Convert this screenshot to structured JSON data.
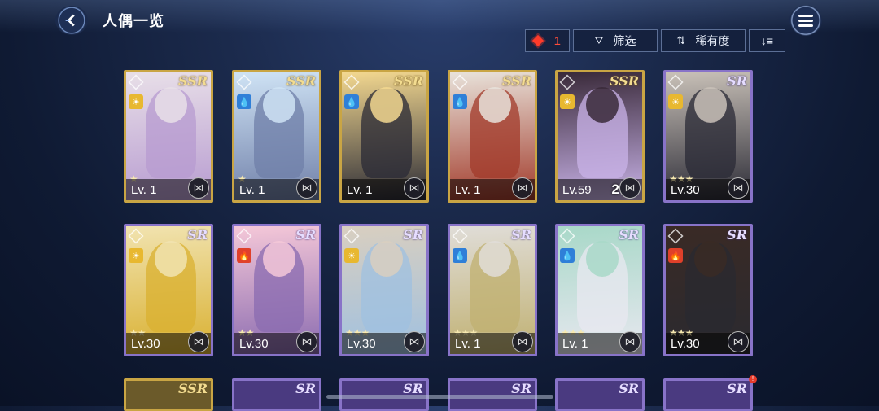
{
  "header": {
    "title": "人偶一览"
  },
  "toolbar": {
    "count": "1",
    "filter_label": "筛选",
    "rarity_label": "稀有度",
    "colors": {
      "accent": "#ff3b2a",
      "border": "#5c6f96"
    }
  },
  "cards": [
    {
      "rarity": "SSR",
      "level": "Lv. 1",
      "dup": "",
      "element": "light",
      "stars": 1
    },
    {
      "rarity": "SSR",
      "level": "Lv. 1",
      "dup": "",
      "element": "water",
      "stars": 1
    },
    {
      "rarity": "SSR",
      "level": "Lv. 1",
      "dup": "",
      "element": "water",
      "stars": 0
    },
    {
      "rarity": "SSR",
      "level": "Lv. 1",
      "dup": "",
      "element": "water",
      "stars": 0
    },
    {
      "rarity": "SSR",
      "level": "Lv.59",
      "dup": "2",
      "element": "light",
      "stars": 0
    },
    {
      "rarity": "SR",
      "level": "Lv.30",
      "dup": "",
      "element": "light",
      "stars": 3
    },
    {
      "rarity": "SR",
      "level": "Lv.30",
      "dup": "",
      "element": "light",
      "stars": 2
    },
    {
      "rarity": "SR",
      "level": "Lv.30",
      "dup": "",
      "element": "fire",
      "stars": 2
    },
    {
      "rarity": "SR",
      "level": "Lv.30",
      "dup": "",
      "element": "light",
      "stars": 3
    },
    {
      "rarity": "SR",
      "level": "Lv. 1",
      "dup": "",
      "element": "water",
      "stars": 3
    },
    {
      "rarity": "SR",
      "level": "Lv. 1",
      "dup": "",
      "element": "water",
      "stars": 3
    },
    {
      "rarity": "SR",
      "level": "Lv.30",
      "dup": "",
      "element": "fire",
      "stars": 3
    }
  ],
  "next_row": [
    "SSR",
    "SR",
    "SR",
    "SR",
    "SR",
    "SR"
  ],
  "element_icons": {
    "light": "sun-icon",
    "water": "water-drop-icon",
    "fire": "flame-icon"
  },
  "element_colors": {
    "light": "#e8b830",
    "water": "#2f7fd8",
    "fire": "#e0402a"
  }
}
